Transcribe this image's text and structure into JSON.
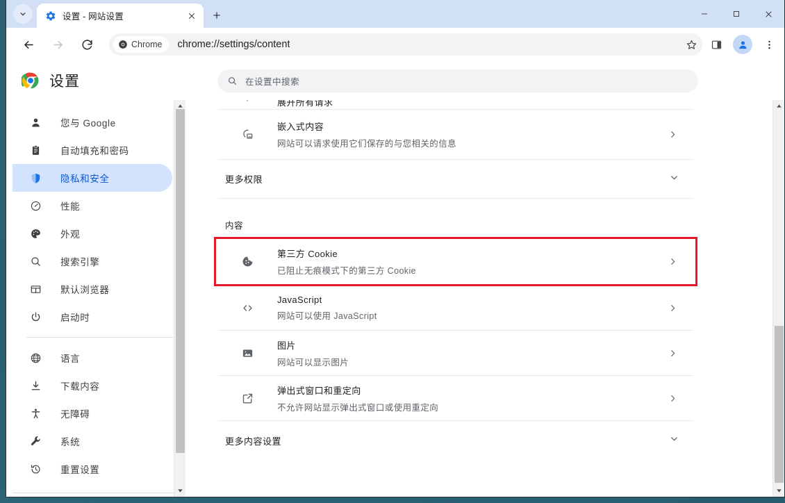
{
  "window": {
    "controls": {
      "minimize": "−",
      "maximize": "□",
      "close": "✕"
    }
  },
  "tabstrip": {
    "tab_search_icon": "chevron-down-icon",
    "tabs": [
      {
        "title": "设置 - 网站设置",
        "favicon": "gear-icon",
        "active": true,
        "close_label": "✕"
      }
    ],
    "new_tab_label": "+"
  },
  "toolbar": {
    "back_icon": "back-arrow-icon",
    "forward_icon": "forward-arrow-icon",
    "reload_icon": "reload-icon",
    "omnibox": {
      "chip_label": "Chrome",
      "chip_icon": "chrome-logo-icon",
      "url": "chrome://settings/content"
    },
    "bookmark_icon": "star-icon",
    "side_panel_icon": "side-panel-icon",
    "profile_icon": "avatar-icon",
    "menu_icon": "three-dot-menu-icon"
  },
  "settings_header": {
    "logo_icon": "chrome-logo-icon",
    "title": "设置"
  },
  "search": {
    "icon": "search-icon",
    "placeholder": "在设置中搜索",
    "value": ""
  },
  "sidebar": {
    "groups": [
      {
        "items": [
          {
            "label": "您与 Google",
            "icon": "person-icon",
            "selected": false
          },
          {
            "label": "自动填充和密码",
            "icon": "clipboard-icon",
            "selected": false
          },
          {
            "label": "隐私和安全",
            "icon": "shield-icon",
            "selected": true
          },
          {
            "label": "性能",
            "icon": "speedometer-icon",
            "selected": false
          },
          {
            "label": "外观",
            "icon": "palette-icon",
            "selected": false
          },
          {
            "label": "搜索引擎",
            "icon": "search-icon",
            "selected": false
          },
          {
            "label": "默认浏览器",
            "icon": "browser-window-icon",
            "selected": false
          },
          {
            "label": "启动时",
            "icon": "power-icon",
            "selected": false
          }
        ]
      },
      {
        "items": [
          {
            "label": "语言",
            "icon": "globe-icon",
            "selected": false
          },
          {
            "label": "下载内容",
            "icon": "download-icon",
            "selected": false
          },
          {
            "label": "无障碍",
            "icon": "accessibility-icon",
            "selected": false
          },
          {
            "label": "系统",
            "icon": "wrench-icon",
            "selected": false
          },
          {
            "label": "重置设置",
            "icon": "history-restore-icon",
            "selected": false
          }
        ]
      }
    ]
  },
  "content": {
    "clipped_row": {
      "title": "展开所有请求"
    },
    "rows_permissions": [
      {
        "title": "嵌入式内容",
        "subtitle": "网站可以请求使用它们保存的与您相关的信息",
        "icon": "embedded-content-icon",
        "arrow": "chevron-right-icon"
      }
    ],
    "more_permissions": {
      "label": "更多权限",
      "arrow": "chevron-down-icon"
    },
    "section_title": "内容",
    "rows_content": [
      {
        "title": "第三方 Cookie",
        "subtitle": "已阻止无痕模式下的第三方 Cookie",
        "icon": "cookie-icon",
        "arrow": "chevron-right-icon",
        "highlighted": true
      },
      {
        "title": "JavaScript",
        "subtitle": "网站可以使用 JavaScript",
        "icon": "code-brackets-icon",
        "arrow": "chevron-right-icon",
        "highlighted": false
      },
      {
        "title": "图片",
        "subtitle": "网站可以显示图片",
        "icon": "image-icon",
        "arrow": "chevron-right-icon",
        "highlighted": false
      },
      {
        "title": "弹出式窗口和重定向",
        "subtitle": "不允许网站显示弹出式窗口或使用重定向",
        "icon": "external-link-icon",
        "arrow": "chevron-right-icon",
        "highlighted": false
      }
    ],
    "more_content_settings": {
      "label": "更多内容设置",
      "arrow": "chevron-down-icon"
    }
  },
  "colors": {
    "accent_blue": "#0b57d0",
    "selected_pill": "#d3e3fd",
    "highlight_red": "#e8192c",
    "tabstrip_bg": "#d2e0f5",
    "desktop": "#2c6478"
  }
}
